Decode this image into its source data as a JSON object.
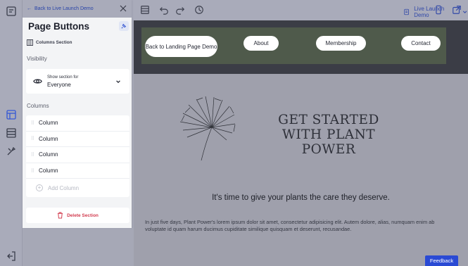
{
  "panel": {
    "back_label": "Back to Live Launch Demo",
    "title": "Page Buttons",
    "subtitle": "Columns Section",
    "visibility_label": "Visibility",
    "visibility_line1": "Show section for",
    "visibility_value": "Everyone",
    "columns_label": "Columns",
    "columns": [
      {
        "label": "Column"
      },
      {
        "label": "Column"
      },
      {
        "label": "Column"
      },
      {
        "label": "Column"
      }
    ],
    "add_column_label": "Add Column",
    "delete_label": "Delete Section"
  },
  "topbar": {
    "page_name": "Live Launch Demo"
  },
  "site": {
    "nav": [
      {
        "label": "Back to Landing Page Demo"
      },
      {
        "label": "About"
      },
      {
        "label": "Membership"
      },
      {
        "label": "Contact"
      }
    ],
    "headline": "GET STARTED WITH PLANT POWER",
    "tagline": "It's time to give your plants the care they deserve.",
    "body": "In just five days, Plant Power's lorem ipsum dolor sit amet, consectetur adipisicing elit. Autem dolore, alias, numquam enim ab voluptate id quam harum ducimus cupiditate similique quisquam et deserunt, recusandae."
  },
  "feedback_label": "Feedback",
  "colors": {
    "accent": "#2a4ad4",
    "danger": "#d23c4f",
    "nav_bg": "#4f5a4b",
    "header_bg": "#3b3d46"
  }
}
